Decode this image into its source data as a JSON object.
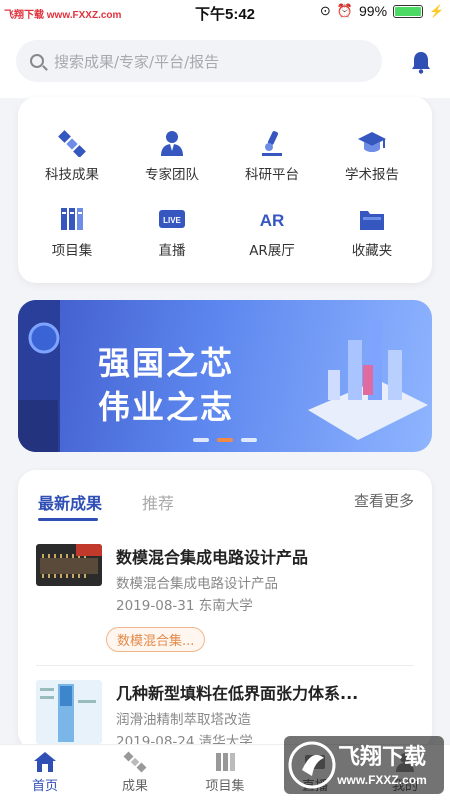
{
  "status_bar": {
    "watermark": "飞翔下载 www.FXXZ.com",
    "time": "下午5:42",
    "battery": "99%",
    "battery_level": 0.99
  },
  "search": {
    "placeholder": "搜索成果/专家/平台/报告"
  },
  "quick_menu": {
    "items": [
      {
        "label": "科技成果",
        "icon": "satellite-icon"
      },
      {
        "label": "专家团队",
        "icon": "expert-icon"
      },
      {
        "label": "科研平台",
        "icon": "microscope-icon"
      },
      {
        "label": "学术报告",
        "icon": "graduation-cap-icon"
      },
      {
        "label": "项目集",
        "icon": "binders-icon"
      },
      {
        "label": "直播",
        "icon": "live-icon"
      },
      {
        "label": "AR展厅",
        "icon": "ar-icon"
      },
      {
        "label": "收藏夹",
        "icon": "folder-icon"
      }
    ]
  },
  "banner": {
    "line1": "强国之芯",
    "line2": "伟业之志",
    "slide_count": 3,
    "active_slide": 2
  },
  "results": {
    "tab_active": "最新成果",
    "tab_inactive": "推荐",
    "more": "查看更多",
    "items": [
      {
        "title": "数模混合集成电路设计产品",
        "subtitle": "数模混合集成电路设计产品",
        "meta": "2019-08-31 东南大学",
        "tag": "数模混合集..."
      },
      {
        "title": "几种新型填料在低界面张力体系...",
        "subtitle": "润滑油精制萃取塔改造",
        "meta": "2019-08-24 清华大学"
      }
    ]
  },
  "bottom_nav": {
    "items": [
      {
        "label": "首页",
        "icon": "home-icon",
        "active": true
      },
      {
        "label": "成果",
        "icon": "satellite-icon",
        "active": false
      },
      {
        "label": "项目集",
        "icon": "binders-icon",
        "active": false
      },
      {
        "label": "直播",
        "icon": "live-icon",
        "active": false
      },
      {
        "label": "我的",
        "icon": "user-icon",
        "active": false
      }
    ]
  },
  "watermark_br": {
    "brand": "飞翔下载",
    "url": "www.FXXZ.com"
  },
  "colors": {
    "accent": "#2f4fb4",
    "tag": "#e38a4a"
  }
}
